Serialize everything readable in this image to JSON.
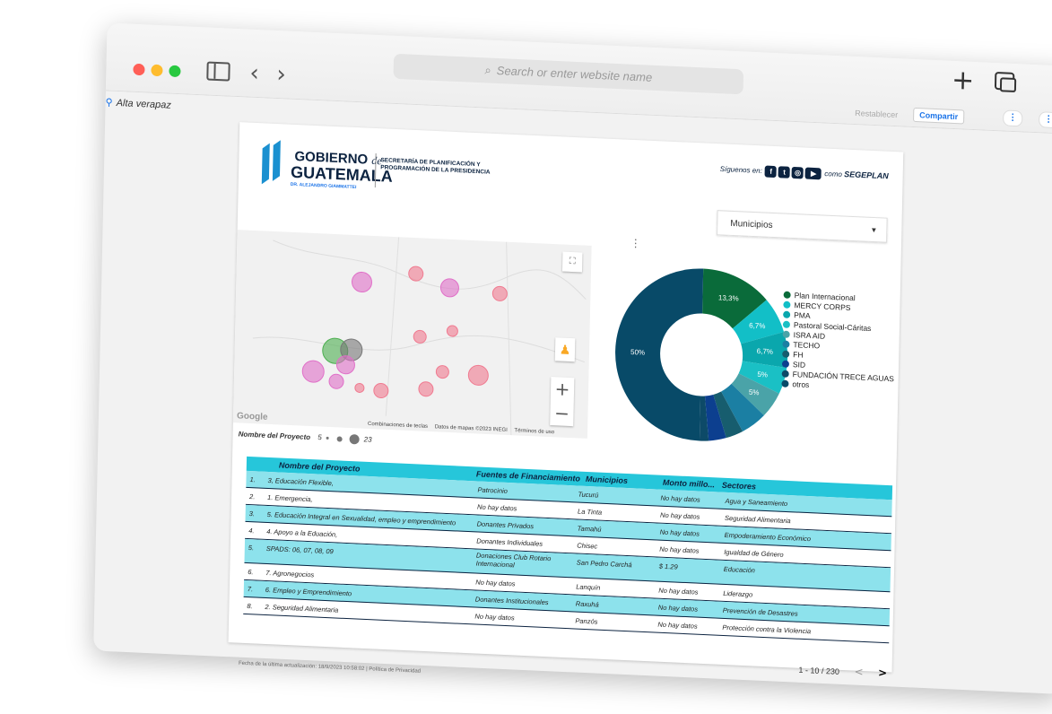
{
  "browser": {
    "search_placeholder": "Search or enter website name",
    "search_icon": "magnifier-icon",
    "toolbar_restablecer": "Restablecer",
    "toolbar_share": "Compartir"
  },
  "page": {
    "region_label": "Alta verapaz"
  },
  "header": {
    "logo_line1": "GOBIERNO",
    "logo_de": "de",
    "logo_line2": "GUATEMALA",
    "logo_sub": "DR. ALEJANDRO GIAMMATTEI",
    "secretaria": "SECRETARÍA DE PLANIFICACIÓN Y PROGRAMACIÓN DE LA PRESIDENCIA",
    "follow_prefix": "Síguenos en:",
    "follow_suffix": "como",
    "follow_brand": "SEGEPLAN"
  },
  "filter": {
    "municipios_label": "Municipios"
  },
  "map": {
    "google": "Google",
    "shortcuts": "Combinaciones de teclas",
    "mapdata": "Datos de mapas ©2023 INEGI",
    "terms": "Términos de uso",
    "size_legend_title": "Nombre del Proyecto",
    "size_min": "5",
    "size_max": "23"
  },
  "chart_data": {
    "type": "pie",
    "donut": true,
    "slices": [
      {
        "name": "Plan Internacional",
        "value": 13.3,
        "label": "13,3%",
        "color": "#0a6b3a"
      },
      {
        "name": "MERCY CORPS",
        "value": 6.7,
        "label": "6,7%",
        "color": "#12bfc7"
      },
      {
        "name": "PMA",
        "value": 6.7,
        "label": "6,7%",
        "color": "#0aa7ad"
      },
      {
        "name": "Pastoral Social-Cáritas",
        "value": 5,
        "label": "5%",
        "color": "#1ac0c5"
      },
      {
        "name": "ISRA AID",
        "value": 5,
        "label": "5%",
        "color": "#4aa3a8"
      },
      {
        "name": "TECHO",
        "value": 5,
        "label": "",
        "color": "#1b7fa3"
      },
      {
        "name": "FH",
        "value": 3.3,
        "label": "",
        "color": "#175d6e"
      },
      {
        "name": "SID",
        "value": 3.3,
        "label": "",
        "color": "#0c3f8f"
      },
      {
        "name": "FUNDACIÓN TRECE AGUAS",
        "value": 1.7,
        "label": "",
        "color": "#0d4a68"
      },
      {
        "name": "otros",
        "value": 50,
        "label": "50%",
        "color": "#084a68"
      }
    ]
  },
  "table": {
    "headers": [
      "Nombre del Proyecto",
      "Fuentes de Financiamiento",
      "Municipios",
      "Monto millo...",
      "Sectores"
    ],
    "rows": [
      {
        "n": "1.",
        "proyecto": "3, Educación Flexible,",
        "fuente": "Patrocinio",
        "municipio": "Tucurú",
        "monto": "No hay datos",
        "sector": "Agua y Saneamiento"
      },
      {
        "n": "2.",
        "proyecto": "1. Emergencia,",
        "fuente": "No hay datos",
        "municipio": "La Tinta",
        "monto": "No hay datos",
        "sector": "Seguridad Alimentaria"
      },
      {
        "n": "3.",
        "proyecto": "5. Educación Integral en Sexualidad, empleo y emprendimiento",
        "fuente": "Donantes Privados",
        "municipio": "Tamahú",
        "monto": "No hay datos",
        "sector": "Empoderamiento Económico"
      },
      {
        "n": "4.",
        "proyecto": "4. Apoyo a la Eduación,",
        "fuente": "Donantes Individuales",
        "municipio": "Chisec",
        "monto": "No hay datos",
        "sector": "Igualdad de Género"
      },
      {
        "n": "5.",
        "proyecto": "SPADS: 06, 07, 08, 09",
        "fuente": "Donaciones Club Rotario Internacional",
        "municipio": "San Pedro Carchá",
        "monto": "$ 1.29",
        "sector": "Educación"
      },
      {
        "n": "6.",
        "proyecto": "7. Agronegocios",
        "fuente": "No hay datos",
        "municipio": "Lanquín",
        "monto": "No hay datos",
        "sector": "Liderazgo"
      },
      {
        "n": "7.",
        "proyecto": "6. Empleo y Emprendimiento",
        "fuente": "Donantes Institucionales",
        "municipio": "Raxuhá",
        "monto": "No hay datos",
        "sector": "Prevención de Desastres"
      },
      {
        "n": "8.",
        "proyecto": "2. Seguridad Alimentaria",
        "fuente": "No hay datos",
        "municipio": "Panzós",
        "monto": "No hay datos",
        "sector": "Protección contra la Violencia"
      }
    ],
    "pager_text": "1 - 10 / 230"
  },
  "footer": {
    "text": "Fecha de la última actualización: 18/9/2023 10:58:02  |  Política de Privacidad"
  }
}
